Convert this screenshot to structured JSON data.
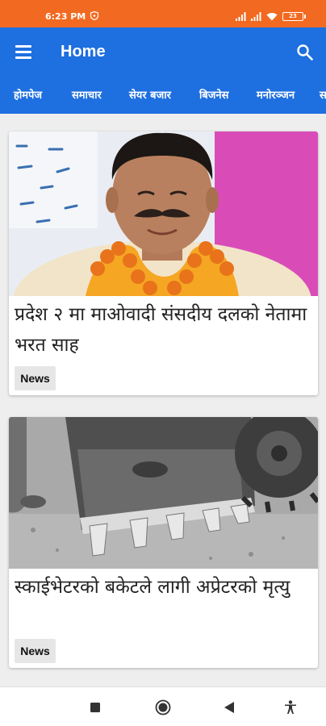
{
  "status_bar": {
    "time": "6:23 PM",
    "battery_level": "23",
    "icons": [
      "shield-icon",
      "signal-icon",
      "signal-icon",
      "wifi-icon",
      "battery-icon"
    ]
  },
  "app_bar": {
    "title": "Home",
    "color": "#1e6fe0",
    "tabs": [
      "होमपेज",
      "समाचार",
      "सेयर बजार",
      "बिजनेस",
      "मनोरञ्जन",
      "स"
    ]
  },
  "articles": [
    {
      "title": "प्रदेश २ मा माओवादी संसदीय दलको नेतामा भरत साह",
      "category": "News",
      "image": "portrait-of-man-with-marigold-garland"
    },
    {
      "title": "स्काईभेटरको बकेटले लागी अप्रेटरको मृत्यु",
      "category": "News",
      "image": "excavator-bucket-on-dirt"
    }
  ],
  "nav_bar": {
    "buttons": [
      "recent-apps-icon",
      "home-icon",
      "back-icon",
      "accessibility-icon"
    ]
  },
  "colors": {
    "status_bar": "#f26a21",
    "app_bar": "#1e6fe0",
    "background": "#eeeeee"
  }
}
